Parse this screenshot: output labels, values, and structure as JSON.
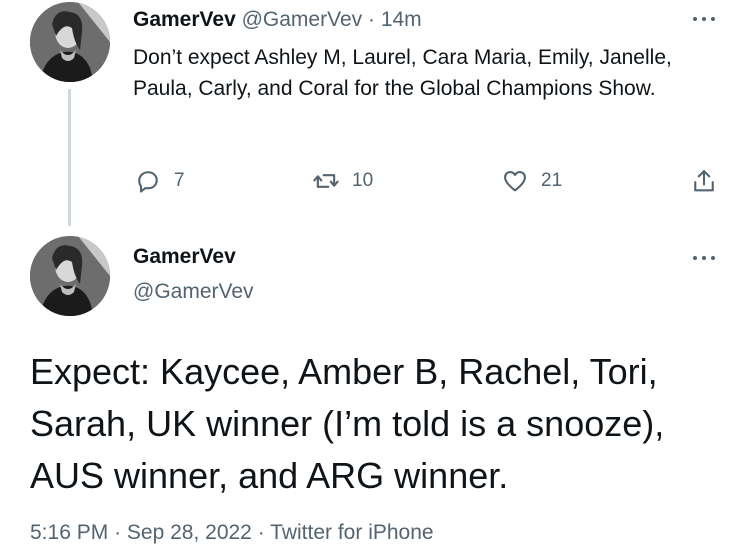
{
  "tweet1": {
    "display_name": "GamerVev",
    "handle": "@GamerVev",
    "separator": "·",
    "time_ago": "14m",
    "text": "Don’t expect Ashley M, Laurel, Cara Maria, Emily, Janelle, Paula, Carly, and Coral for the Global Champions Show.",
    "actions": {
      "reply_count": "7",
      "retweet_count": "10",
      "like_count": "21"
    }
  },
  "tweet2": {
    "display_name": "GamerVev",
    "handle": "@GamerVev",
    "text": "Expect: Kaycee, Amber B, Rachel, Tori, Sarah, UK winner (I’m told is a snooze), AUS winner, and ARG winner.",
    "time": "5:16 PM",
    "separator": "·",
    "date": "Sep 28, 2022",
    "separator2": "·",
    "source": "Twitter for iPhone"
  },
  "colors": {
    "text": "#0f1419",
    "muted": "#536471",
    "thread_line": "#cfd9de"
  },
  "icons": [
    "reply-icon",
    "retweet-icon",
    "like-icon",
    "share-icon",
    "more-icon"
  ]
}
